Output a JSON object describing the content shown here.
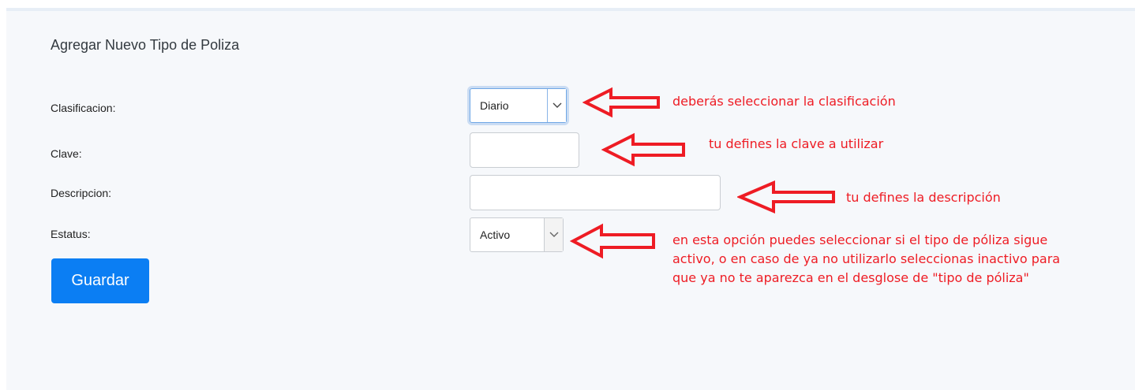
{
  "form": {
    "title": "Agregar Nuevo Tipo de Poliza",
    "fields": {
      "clasificacion": {
        "label": "Clasificacion:",
        "value": "Diario"
      },
      "clave": {
        "label": "Clave:",
        "value": ""
      },
      "descripcion": {
        "label": "Descripcion:",
        "value": ""
      },
      "estatus": {
        "label": "Estatus:",
        "value": "Activo"
      }
    },
    "save_label": "Guardar"
  },
  "annotations": {
    "clasificacion": "deberás seleccionar la clasificación",
    "clave": "tu defines la clave a utilizar",
    "descripcion": "tu defines la descripción",
    "estatus_lines": [
      "en esta opción puedes seleccionar si el tipo de póliza sigue",
      "activo, o en caso de ya no utilizarlo seleccionas inactivo para",
      "que ya no te aparezca en el desglose de \"tipo de póliza\""
    ]
  },
  "colors": {
    "accent": "#0b7ef3",
    "annotation": "#ee1c24",
    "panel_bg": "#f6f8fb"
  },
  "icons": {
    "select_chevron": "chevron-down-icon",
    "annotation_arrow": "left-arrow-icon"
  }
}
